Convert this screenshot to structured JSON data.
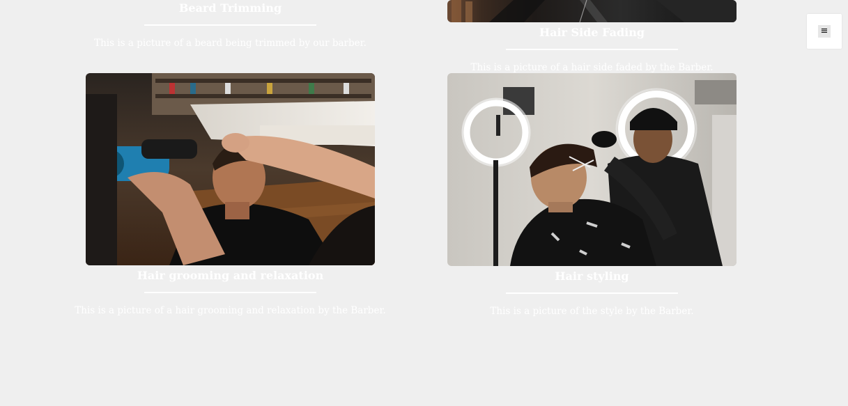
{
  "services": [
    {
      "title": "Beard Trimming",
      "caption": "This is a picture of a beard being trimmed by our barber."
    },
    {
      "title": "Hair Side Fading",
      "caption": "This is a picture of a hair side faded by the Barber."
    },
    {
      "title": "Hair grooming and relaxation",
      "caption": "This is a picture of a hair grooming and relaxation by the Barber."
    },
    {
      "title": "Hair styling",
      "caption": "This is a picture of the style by the Barber."
    }
  ],
  "menu": {
    "icon": "hamburger-menu-icon",
    "glyph": "≡"
  },
  "colors": {
    "background": "#efefef",
    "text": "#ffffff",
    "menu_bg": "#ffffff"
  }
}
